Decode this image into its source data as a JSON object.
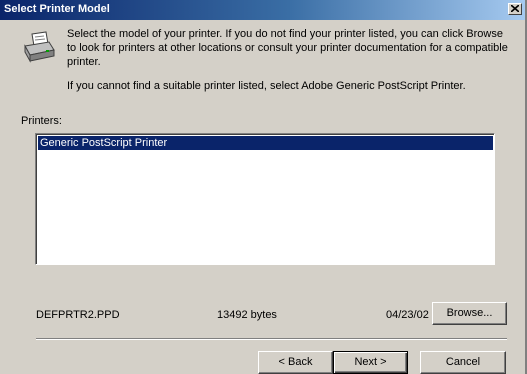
{
  "window": {
    "title": "Select Printer Model"
  },
  "instructions": {
    "main": "Select the model of your printer. If you do not find your printer listed, you can click Browse to look for printers at other locations or consult your printer documentation for a compatible printer.",
    "fallback": "If you cannot find a suitable printer listed, select Adobe Generic PostScript Printer."
  },
  "printers": {
    "label": "Printers:",
    "items": [
      "Generic PostScript Printer"
    ],
    "selected_index": 0
  },
  "file_info": {
    "name": "DEFPRTR2.PPD",
    "size": "13492 bytes",
    "date": "04/23/02"
  },
  "buttons": {
    "browse": "Browse...",
    "back": "< Back",
    "next": "Next >",
    "cancel": "Cancel"
  },
  "colors": {
    "title_bar": "#0a246a",
    "selection": "#0a246a",
    "dialog_face": "#d4d0c8"
  },
  "icons": {
    "printer": "printer-icon",
    "close": "close-icon"
  }
}
